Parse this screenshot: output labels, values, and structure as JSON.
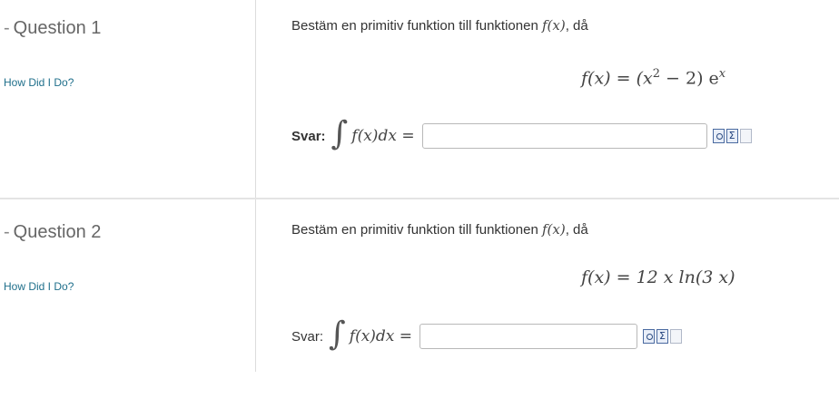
{
  "questions": [
    {
      "title": "Question 1",
      "how_did_i_do": "How Did I Do?",
      "prompt_text": "Bestäm en primitiv funktion till funktionen ",
      "prompt_math": "f(x)",
      "prompt_suffix": ", då",
      "formula_lhs": "f(x) = (x",
      "formula_exp": "2",
      "formula_mid": " − 2) e",
      "formula_exp2": "x",
      "answer_label": "Svar:",
      "integral_symbol": "∫",
      "integral_expr": "f(x)dx =",
      "answer_value": ""
    },
    {
      "title": "Question 2",
      "how_did_i_do": "How Did I Do?",
      "prompt_text": "Bestäm en primitiv funktion till funktionen ",
      "prompt_math": "f(x)",
      "prompt_suffix": ", då",
      "formula": "f(x) = 12 x ln(3 x)",
      "answer_label": "Svar:",
      "integral_symbol": "∫",
      "integral_expr": "f(x)dx =",
      "answer_value": ""
    }
  ],
  "icons": [
    "preview-icon",
    "equation-editor-icon",
    "help-doc-icon"
  ]
}
